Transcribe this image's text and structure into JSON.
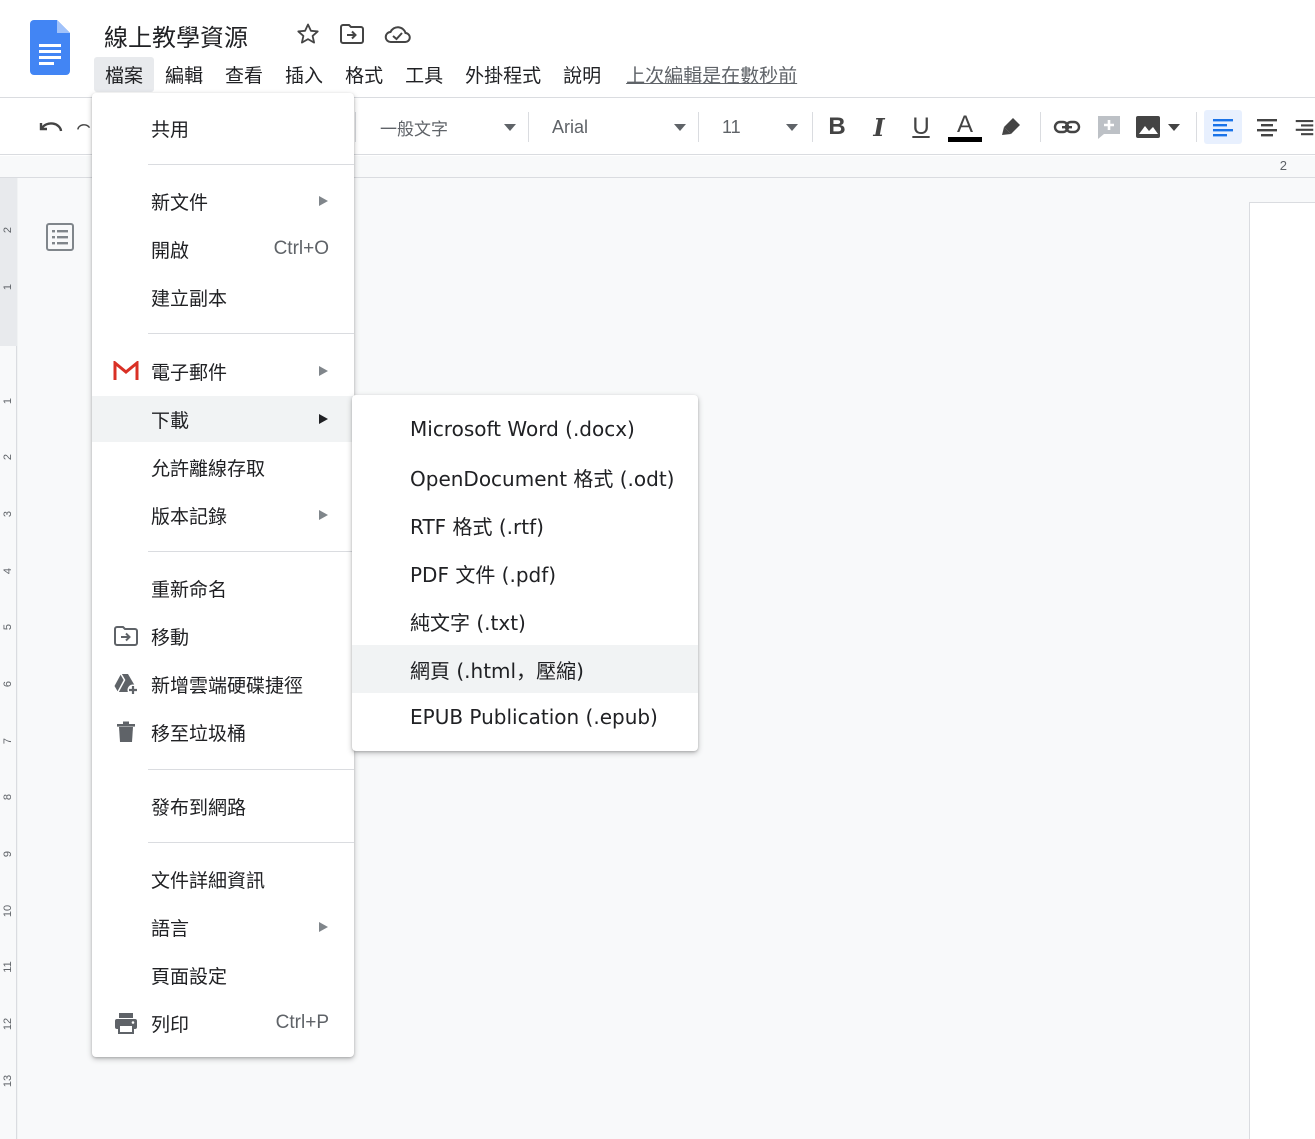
{
  "doc": {
    "title": "線上教學資源"
  },
  "menubar": {
    "items": [
      "檔案",
      "編輯",
      "查看",
      "插入",
      "格式",
      "工具",
      "外掛程式",
      "說明"
    ],
    "last_edit": "上次編輯是在數秒前"
  },
  "toolbar": {
    "style_select": "一般文字",
    "font_select": "Arial",
    "size_select": "11",
    "bold": "B",
    "italic": "I",
    "underline": "U",
    "text_color": "A"
  },
  "ruler": {
    "h_number": "2",
    "v_numbers": [
      "2",
      "1",
      "1",
      "2",
      "3",
      "4",
      "5",
      "6",
      "7",
      "8",
      "9",
      "10",
      "11",
      "12",
      "13"
    ]
  },
  "file_menu": {
    "share": "共用",
    "new_doc": "新文件",
    "open": "開啟",
    "open_shortcut": "Ctrl+O",
    "make_copy": "建立副本",
    "email": "電子郵件",
    "download": "下載",
    "offline": "允許離線存取",
    "version_history": "版本記錄",
    "rename": "重新命名",
    "move": "移動",
    "add_shortcut": "新增雲端硬碟捷徑",
    "trash": "移至垃圾桶",
    "publish": "發布到網路",
    "details": "文件詳細資訊",
    "language": "語言",
    "page_setup": "頁面設定",
    "print": "列印",
    "print_shortcut": "Ctrl+P"
  },
  "download_menu": {
    "items": [
      "Microsoft Word (.docx)",
      "OpenDocument 格式 (.odt)",
      "RTF 格式 (.rtf)",
      "PDF 文件 (.pdf)",
      "純文字 (.txt)",
      "網頁 (.html，壓縮)",
      "EPUB Publication (.epub)"
    ]
  },
  "colors": {
    "accent": "#1a73e8",
    "gmail_red": "#d93025",
    "text": "#202124",
    "hover": "#f1f3f4"
  }
}
